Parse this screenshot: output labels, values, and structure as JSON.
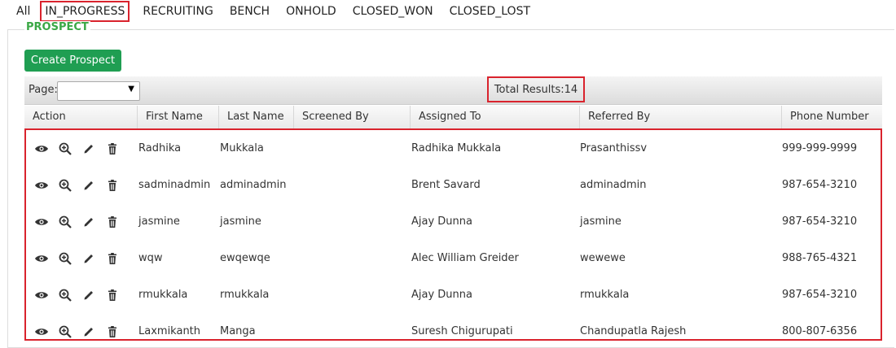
{
  "tabs": [
    {
      "label": "All",
      "active": false
    },
    {
      "label": "IN_PROGRESS",
      "active": true
    },
    {
      "label": "RECRUITING",
      "active": false
    },
    {
      "label": "BENCH",
      "active": false
    },
    {
      "label": "ONHOLD",
      "active": false
    },
    {
      "label": "CLOSED_WON",
      "active": false
    },
    {
      "label": "CLOSED_LOST",
      "active": false
    }
  ],
  "section_title": "PROSPECT",
  "create_button": "Create Prospect",
  "pager": {
    "label": "Page:",
    "selected": "",
    "total": "Total Results:14"
  },
  "columns": [
    "Action",
    "First Name",
    "Last Name",
    "Screened By",
    "Assigned To",
    "Referred By",
    "Phone Number"
  ],
  "rows": [
    {
      "first": "Radhika",
      "last": "Mukkala",
      "screened": "",
      "assigned": "Radhika Mukkala",
      "referred": "Prasanthissv",
      "phone": "999-999-9999"
    },
    {
      "first": "sadminadmin",
      "last": "adminadmin",
      "screened": "",
      "assigned": "Brent Savard",
      "referred": "adminadmin",
      "phone": "987-654-3210"
    },
    {
      "first": "jasmine",
      "last": "jasmine",
      "screened": "",
      "assigned": "Ajay Dunna",
      "referred": "jasmine",
      "phone": "987-654-3210"
    },
    {
      "first": "wqw",
      "last": "ewqewqe",
      "screened": "",
      "assigned": "Alec William Greider",
      "referred": "wewewe",
      "phone": "988-765-4321"
    },
    {
      "first": "rmukkala",
      "last": "rmukkala",
      "screened": "",
      "assigned": "Ajay Dunna",
      "referred": "rmukkala",
      "phone": "987-654-3210"
    },
    {
      "first": "Laxmikanth",
      "last": "Manga",
      "screened": "",
      "assigned": "Suresh Chigurupati",
      "referred": "Chandupatla Rajesh",
      "phone": "800-807-6356"
    }
  ],
  "action_icons": [
    "eye-icon",
    "zoom-in-icon",
    "pencil-icon",
    "trash-icon"
  ],
  "colors": {
    "accent_red": "#d9232d",
    "button_green": "#1f9e52",
    "legend_green": "#3aa845"
  }
}
